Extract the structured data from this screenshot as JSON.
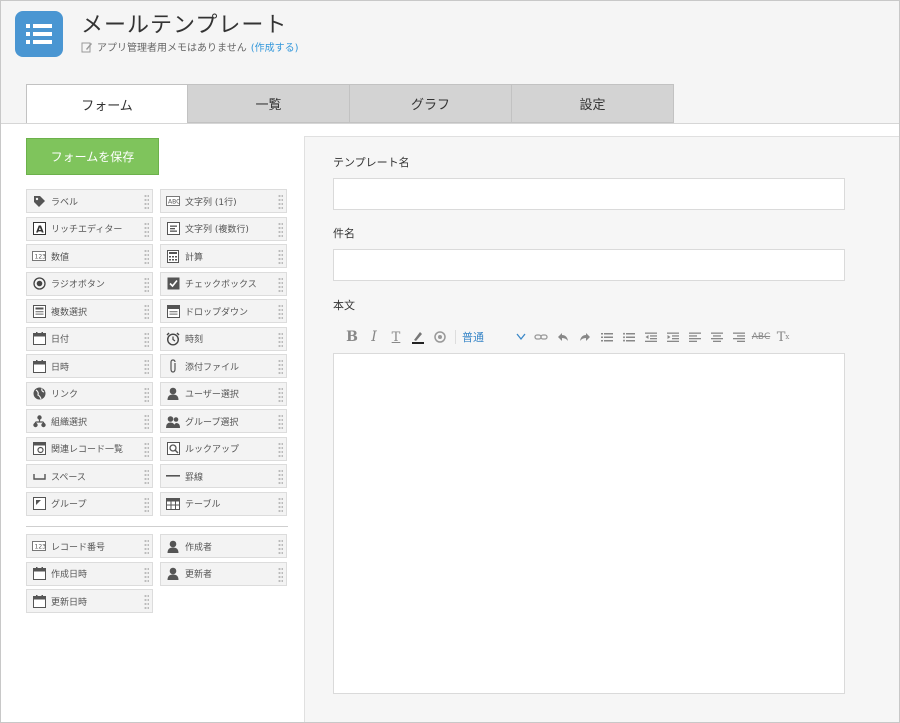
{
  "app": {
    "title": "メールテンプレート",
    "memo_text": "アプリ管理者用メモはありません",
    "memo_link": "(作成する)"
  },
  "tabs": [
    {
      "label": "フォーム",
      "active": true
    },
    {
      "label": "一覧",
      "active": false
    },
    {
      "label": "グラフ",
      "active": false
    },
    {
      "label": "設定",
      "active": false
    }
  ],
  "save_button": "フォームを保存",
  "palette": {
    "fields": [
      {
        "label": "ラベル",
        "icon": "tag-icon"
      },
      {
        "label": "文字列 (1行)",
        "icon": "abc-icon"
      },
      {
        "label": "リッチエディター",
        "icon": "rich-editor-icon"
      },
      {
        "label": "文字列 (複数行)",
        "icon": "multiline-text-icon"
      },
      {
        "label": "数値",
        "icon": "number-icon"
      },
      {
        "label": "計算",
        "icon": "calculator-icon"
      },
      {
        "label": "ラジオボタン",
        "icon": "radio-icon"
      },
      {
        "label": "チェックボックス",
        "icon": "checkbox-icon"
      },
      {
        "label": "複数選択",
        "icon": "multi-select-icon"
      },
      {
        "label": "ドロップダウン",
        "icon": "dropdown-icon"
      },
      {
        "label": "日付",
        "icon": "calendar-icon"
      },
      {
        "label": "時刻",
        "icon": "clock-icon"
      },
      {
        "label": "日時",
        "icon": "calendar-time-icon"
      },
      {
        "label": "添付ファイル",
        "icon": "paperclip-icon"
      },
      {
        "label": "リンク",
        "icon": "globe-icon"
      },
      {
        "label": "ユーザー選択",
        "icon": "user-icon"
      },
      {
        "label": "組織選択",
        "icon": "org-icon"
      },
      {
        "label": "グループ選択",
        "icon": "group-icon"
      },
      {
        "label": "関連レコード一覧",
        "icon": "related-records-icon"
      },
      {
        "label": "ルックアップ",
        "icon": "lookup-icon"
      },
      {
        "label": "スペース",
        "icon": "space-icon"
      },
      {
        "label": "罫線",
        "icon": "line-icon"
      },
      {
        "label": "グループ",
        "icon": "group-box-icon"
      },
      {
        "label": "テーブル",
        "icon": "table-icon"
      }
    ],
    "system_fields": [
      {
        "label": "レコード番号",
        "icon": "number-icon"
      },
      {
        "label": "作成者",
        "icon": "user-icon"
      },
      {
        "label": "作成日時",
        "icon": "calendar-icon"
      },
      {
        "label": "更新者",
        "icon": "user-icon"
      },
      {
        "label": "更新日時",
        "icon": "calendar-icon"
      }
    ]
  },
  "form": {
    "field1_label": "テンプレート名",
    "field2_label": "件名",
    "field3_label": "本文",
    "font_select": "普通"
  }
}
